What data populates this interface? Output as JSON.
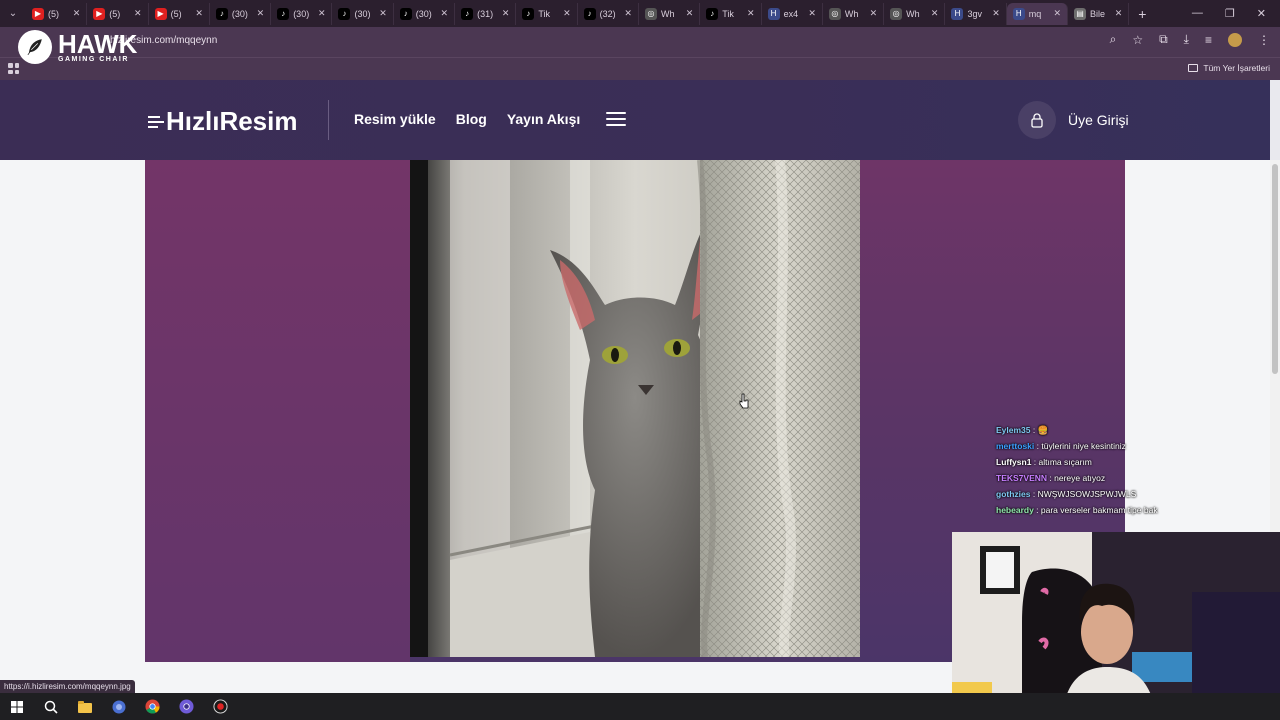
{
  "browser": {
    "tabs": [
      {
        "title": "(5)",
        "favicon": "youtube-icon",
        "color": "#e02020"
      },
      {
        "title": "(5)",
        "favicon": "youtube-icon",
        "color": "#e02020"
      },
      {
        "title": "(5)",
        "favicon": "youtube-icon",
        "color": "#e02020"
      },
      {
        "title": "(30)",
        "favicon": "tiktok-icon",
        "color": "#000000"
      },
      {
        "title": "(30)",
        "favicon": "tiktok-icon",
        "color": "#000000"
      },
      {
        "title": "(30)",
        "favicon": "tiktok-icon",
        "color": "#000000"
      },
      {
        "title": "(30)",
        "favicon": "tiktok-icon",
        "color": "#000000"
      },
      {
        "title": "(31)",
        "favicon": "tiktok-icon",
        "color": "#000000"
      },
      {
        "title": "Tik",
        "favicon": "tiktok-icon",
        "color": "#000000"
      },
      {
        "title": "(32)",
        "favicon": "tiktok-icon",
        "color": "#000000"
      },
      {
        "title": "Wh",
        "favicon": "globe-icon",
        "color": "#555555"
      },
      {
        "title": "Tik",
        "favicon": "tiktok-icon",
        "color": "#000000"
      },
      {
        "title": "ex4",
        "favicon": "h-icon",
        "color": "#3b4a8a"
      },
      {
        "title": "Wh",
        "favicon": "globe-icon",
        "color": "#555555"
      },
      {
        "title": "Wh",
        "favicon": "globe-icon",
        "color": "#555555"
      },
      {
        "title": "3gv",
        "favicon": "h-icon",
        "color": "#3b4a8a"
      },
      {
        "title": "mq",
        "favicon": "h-icon",
        "color": "#3b4a8a",
        "active": true
      },
      {
        "title": "Bile",
        "favicon": "doc-icon",
        "color": "#6d6d6d"
      }
    ],
    "url": "hizliresim.com/mqqeynn",
    "url_prefix": "",
    "bookmarks_label": "Tüm Yer İşaretleri",
    "status_url": "https://i.hizliresim.com/mqqeynn.jpg"
  },
  "overlay": {
    "brand": "HAWK",
    "brand_sub": "GAMING CHAIR"
  },
  "site": {
    "logo": "HızlıResim",
    "nav": [
      "Resim yükle",
      "Blog",
      "Yayın Akışı"
    ],
    "login_label": "Üye Girişi"
  },
  "chat": [
    {
      "user": "Eylem35",
      "message": "🍔",
      "color": "#7ec8f0"
    },
    {
      "user": "merttoski",
      "message": "tüylerini niye kesintiniz",
      "color": "#3aa0ff"
    },
    {
      "user": "Luffysn1",
      "message": "altıma sıçarım",
      "color": "#ffffff"
    },
    {
      "user": "TEKS7VENN",
      "message": "nereye atıyoz",
      "color": "#c77dff"
    },
    {
      "user": "gothzies",
      "message": "NWŞWJSOWJSPWJWLS",
      "color": "#7ec8f0"
    },
    {
      "user": "hebeardy",
      "message": "para verseler bakmam tipe bak",
      "color": "#8ee6a8"
    }
  ],
  "colors": {
    "header_bg": "#3b2d55",
    "stage_bg": "#6e3567",
    "browser_chrome": "#4b3752"
  }
}
